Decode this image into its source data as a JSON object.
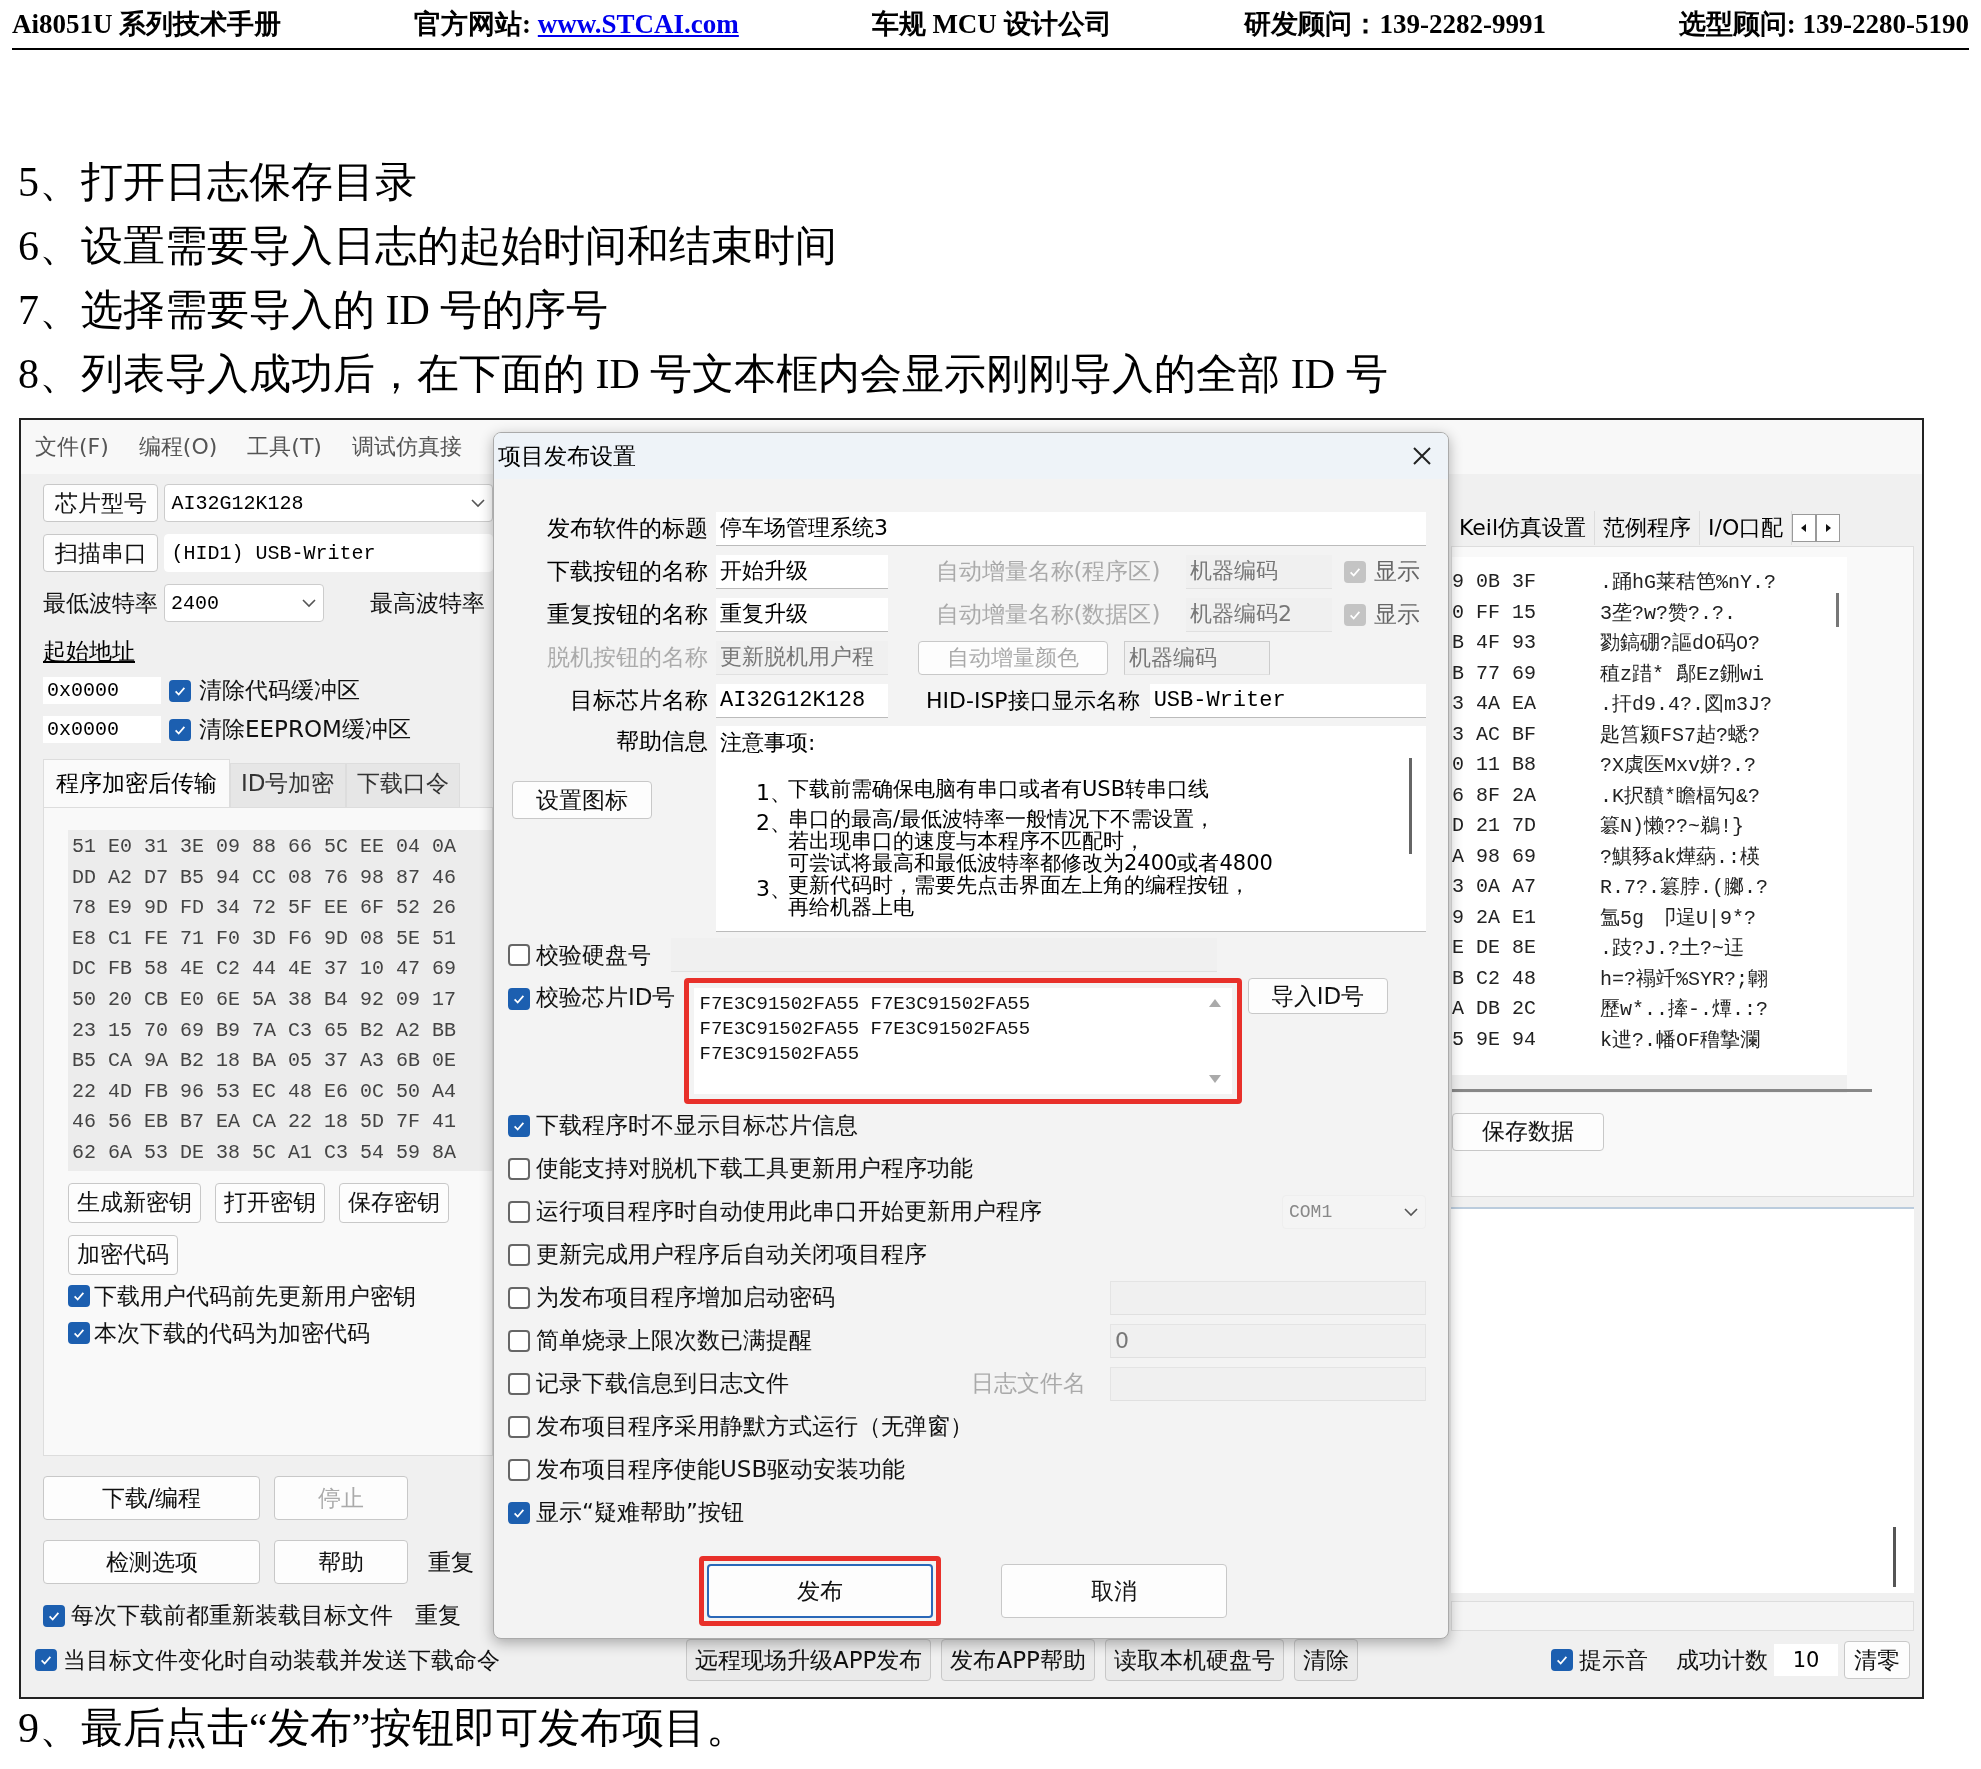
{
  "header": {
    "manual": "Ai8051U 系列技术手册",
    "website_label": "官方网站:",
    "website": "www.STCAI.com",
    "company": "车规 MCU 设计公司",
    "rd_consultant": "研发顾问：139-2282-9991",
    "selection_consultant": "选型顾问: 139-2280-5190"
  },
  "steps_before": [
    "5、打开日志保存目录",
    "6、设置需要导入日志的起始时间和结束时间",
    "7、选择需要导入的 ID 号的序号",
    "8、列表导入成功后，在下面的 ID 号文本框内会显示刚刚导入的全部 ID 号"
  ],
  "main_window": {
    "menu": [
      "文件(F)",
      "编程(O)",
      "工具(T)",
      "调试仿真接"
    ],
    "left": {
      "chip_button": "芯片型号",
      "chip_value": "AI32G12K128",
      "scan_button": "扫描串口",
      "port_value": "(HID1) USB-Writer",
      "min_baud_label": "最低波特率",
      "min_baud_value": "2400",
      "max_baud_label": "最高波特率",
      "start_address_label": "起始地址",
      "address_rows": [
        {
          "value": "0x0000",
          "label": "清除代码缓冲区",
          "checked": true
        },
        {
          "value": "0x0000",
          "label": "清除EEPROM缓冲区",
          "checked": true
        }
      ],
      "tabs": [
        {
          "label": "程序加密后传输",
          "selected": true
        },
        {
          "label": "ID号加密",
          "selected": false
        },
        {
          "label": "下载口令",
          "selected": false
        }
      ],
      "hex_rows": [
        "51 E0 31 3E 09 88 66 5C EE 04 0A",
        "DD A2 D7 B5 94 CC 08 76 98 87 46",
        "78 E9 9D FD 34 72 5F EE 6F 52 26",
        "E8 C1 FE 71 F0 3D F6 9D 08 5E 51",
        "DC FB 58 4E C2 44 4E 37 10 47 69",
        "50 20 CB E0 6E 5A 38 B4 92 09 17",
        "23 15 70 69 B9 7A C3 65 B2 A2 BB",
        "B5 CA 9A B2 18 BA 05 37 A3 6B 0E",
        "22 4D FB 96 53 EC 48 E6 0C 50 A4",
        "46 56 EB B7 EA CA 22 18 5D 7F 41",
        "62 6A 53 DE 38 5C A1 C3 54 59 8A"
      ],
      "key_buttons": [
        "生成新密钥",
        "打开密钥",
        "保存密钥",
        "加密代码"
      ],
      "key_options": [
        {
          "label": "下载用户代码前先更新用户密钥",
          "checked": true
        },
        {
          "label": "本次下载的代码为加密代码",
          "checked": true
        }
      ],
      "action_buttons": [
        {
          "label": "下载/编程",
          "disabled": false
        },
        {
          "label": "停止",
          "disabled": true
        },
        {
          "label": "检测选项",
          "disabled": false
        },
        {
          "label": "帮助",
          "disabled": false
        }
      ],
      "repeat_labels": [
        "重复",
        "重复"
      ],
      "reload_option": {
        "label": "每次下载前都重新装载目标文件",
        "checked": true
      }
    },
    "right": {
      "tabs": [
        {
          "label": "Keil仿真设置",
          "selected": false
        },
        {
          "label": "范例程序",
          "selected": false
        },
        {
          "label": "I/O口配",
          "selected": false
        }
      ],
      "hex_rows": [
        {
          "hex": "9 0B 3F",
          "ascii": ".踊hG莱秸笆%nY.?"
        },
        {
          "hex": "0 FF 15",
          "ascii": "3垄?w?赞?.?."
        },
        {
          "hex": "B 4F 93",
          "ascii": "勠鎬硼?謳dO码O?"
        },
        {
          "hex": "B 77 69",
          "ascii": "稙z踖*  鄬Ez鉶wi"
        },
        {
          "hex": "3 4A EA",
          "ascii": ".扞d9.4?.図m3J?"
        },
        {
          "hex": "3 AC BF",
          "ascii": "匙筥颍FS7趈?蟋?"
        },
        {
          "hex": "0 11 B8",
          "ascii": "?X虡医Mxv姘?.?"
        },
        {
          "hex": "6 8F 2A",
          "ascii": ".K択馩*瞻楅勼&?"
        },
        {
          "hex": "D 21 7D",
          "ascii": "簒N)懒??~鵜!}"
        },
        {
          "hex": "A 98 69",
          "ascii": "?鯕豩ak燁蒳.:楧"
        },
        {
          "hex": "3 0A A7",
          "ascii": "R.7?.簒脖.(膷.?"
        },
        {
          "hex": "9 2A E1",
          "ascii": "  氲5g 卩逞U|9*?"
        },
        {
          "hex": "E DE 8E",
          "ascii": ".跂?J.?土?~迋"
        },
        {
          "hex": "B C2 48",
          "ascii": "h=?禢竏%SYR?;翺"
        },
        {
          "hex": "A DB 2C",
          "ascii": "歷w*..撁-.燂.:?"
        },
        {
          "hex": "5 9E 94",
          "ascii": "k迣?.幡OF穞摯瀾"
        }
      ],
      "save_button": "保存数据"
    },
    "bottom": {
      "auto_option": {
        "label": "当目标文件变化时自动装载并发送下载命令",
        "checked": true
      },
      "buttons": [
        "远程现场升级APP发布",
        "发布APP帮助",
        "读取本机硬盘号",
        "清除"
      ],
      "beep": {
        "label": "提示音",
        "checked": true
      },
      "count_label": "成功计数",
      "count_value": "10",
      "reset_button": "清零"
    }
  },
  "dialog": {
    "title": "项目发布设置",
    "software_title": {
      "label": "发布软件的标题",
      "value": "停车场管理系统3"
    },
    "name_rows": [
      {
        "label": "下载按钮的名称",
        "value": "开始升级",
        "auto_label": "自动增量名称(程序区)",
        "auto_value": "机器编码",
        "show_label": "显示",
        "show_checked": true
      },
      {
        "label": "重复按钮的名称",
        "value": "重复升级",
        "auto_label": "自动增量名称(数据区)",
        "auto_value": "机器编码2",
        "show_label": "显示",
        "show_checked": true
      }
    ],
    "offline_row": {
      "label": "脱机按钮的名称",
      "value": "更新脱机用户程",
      "disabled": true,
      "color_button": "自动增量颜色",
      "auto_value": "机器编码"
    },
    "chip_row": {
      "label": "目标芯片名称",
      "value": "AI32G12K128",
      "hid_label": "HID-ISP接口显示名称",
      "hid_value": "USB-Writer"
    },
    "help": {
      "label": "帮助信息",
      "heading": "注意事项:",
      "items": [
        {
          "marker": "1、",
          "lines": [
            "下载前需确保电脑有串口或者有USB转串口线"
          ]
        },
        {
          "marker": "2、",
          "lines": [
            "串口的最高/最低波特率一般情况下不需设置，",
            "若出现串口的速度与本程序不匹配时，",
            "可尝试将最高和最低波特率都修改为2400或者4800"
          ]
        },
        {
          "marker": "3、",
          "lines": [
            "更新代码时，需要先点击界面左上角的编程按钮，",
            "再给机器上电"
          ]
        }
      ],
      "icon_button": "设置图标"
    },
    "disk_check": {
      "label": "校验硬盘号",
      "checked": false
    },
    "chip_id_check": {
      "label": "校验芯片ID号",
      "checked": true,
      "highlighted": true,
      "ids": [
        "F7E3C91502FA55 F7E3C91502FA55",
        "F7E3C91502FA55 F7E3C91502FA55",
        "F7E3C91502FA55"
      ],
      "import_button": "导入ID号"
    },
    "options": [
      {
        "label": "下载程序时不显示目标芯片信息",
        "checked": true,
        "kind": "plain"
      },
      {
        "label": "使能支持对脱机下载工具更新用户程序功能",
        "checked": false,
        "kind": "plain"
      },
      {
        "label": "运行项目程序时自动使用此串口开始更新用户程序",
        "checked": false,
        "kind": "dropdown",
        "value": "COM1"
      },
      {
        "label": "更新完成用户程序后自动关闭项目程序",
        "checked": false,
        "kind": "plain"
      },
      {
        "label": "为发布项目程序增加启动密码",
        "checked": false,
        "kind": "field"
      },
      {
        "label": "简单烧录上限次数已满提醒",
        "checked": false,
        "kind": "field",
        "value": "0"
      },
      {
        "label": "记录下载信息到日志文件",
        "checked": false,
        "kind": "field",
        "field_label": "日志文件名"
      },
      {
        "label": "发布项目程序采用静默方式运行（无弹窗）",
        "checked": false,
        "kind": "plain"
      },
      {
        "label": "发布项目程序使能USB驱动安装功能",
        "checked": false,
        "kind": "plain"
      },
      {
        "label": "显示“疑难帮助”按钮",
        "checked": true,
        "kind": "plain"
      }
    ],
    "buttons": [
      {
        "label": "发布",
        "highlighted": true
      },
      {
        "label": "取消",
        "highlighted": false
      }
    ]
  },
  "step_after": "9、最后点击“发布”按钮即可发布项目。"
}
